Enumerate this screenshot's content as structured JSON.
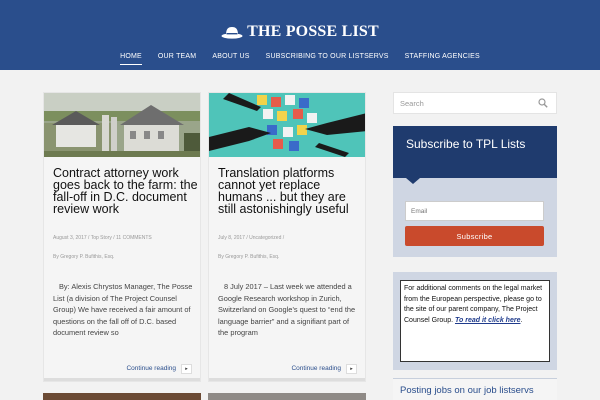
{
  "site": {
    "title": "THE POSSE LIST",
    "logo_icon": "hat-icon"
  },
  "nav": {
    "items": [
      {
        "label": "HOME",
        "active": true
      },
      {
        "label": "OUR TEAM"
      },
      {
        "label": "ABOUT US"
      },
      {
        "label": "SUBSCRIBING TO OUR LISTSERVS"
      },
      {
        "label": "STAFFING AGENCIES"
      }
    ]
  },
  "posts": [
    {
      "title": "Contract attorney work goes back to the farm: the fall-off in D.C. document review work",
      "meta": "August 3, 2017 / Top Story / 11 COMMENTS",
      "author": "By Gregory P. Bufithis, Esq.",
      "excerpt": "By: Alexis Chrystos Manager, The Posse List (a division of The Project Counsel Group)          We have received a fair amount of questions on the fall off of D.C. based document review so",
      "continue_label": "Continue reading",
      "image": "farm-image"
    },
    {
      "title": "Translation platforms cannot yet replace humans ... but they are still astonishingly useful",
      "meta": "July 8, 2017 / Uncategorized /",
      "author": "By Gregory P. Bufithis, Esq.",
      "excerpt": "8 July 2017 – Last week we attended a Google Research workshop in Zurich, Switzerland on Google’s quest to “end the language barrier” and a signifiant part of the program",
      "continue_label": "Continue reading",
      "image": "translation-image"
    }
  ],
  "sidebar": {
    "search": {
      "placeholder": "Search"
    },
    "subscribe": {
      "title": "Subscribe to TPL Lists",
      "email_placeholder": "Email",
      "button_label": "Subscribe"
    },
    "notice": {
      "text": "For additional comments on the legal market from the European perspective, please go to the site of our parent company, The Project Counsel Group. ",
      "link_text": "To read it click here",
      "suffix": "."
    },
    "jobs": {
      "title": "Posting jobs on our job listservs"
    }
  },
  "colors": {
    "header": "#2a4e8c",
    "subscribe_head": "#1f3b6e",
    "subscribe_button": "#c94a2c",
    "widget_bg": "#cfd6e3"
  }
}
